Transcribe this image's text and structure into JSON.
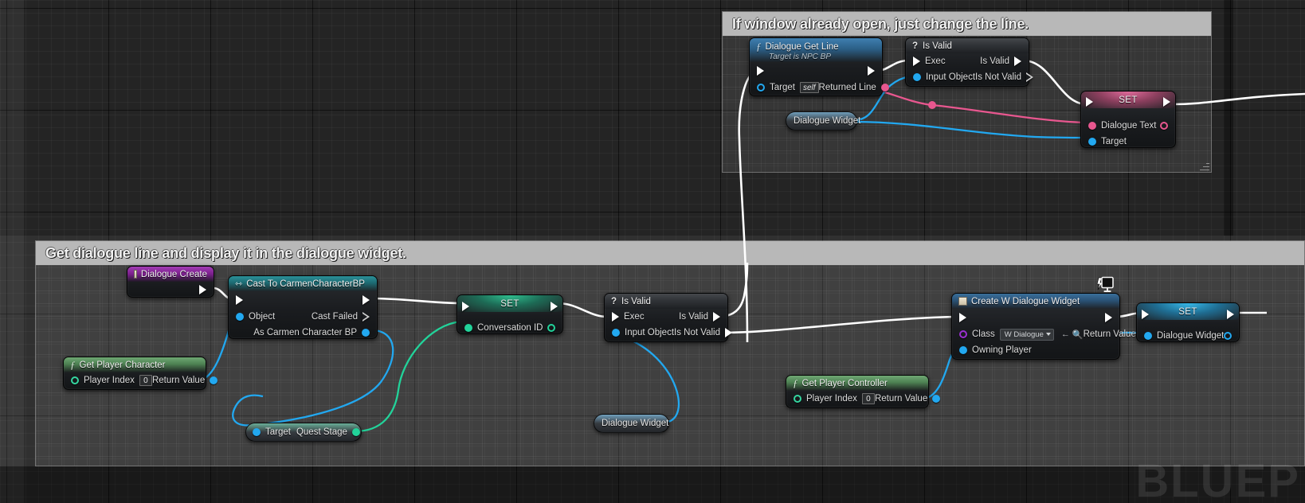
{
  "app": {
    "editor": "Unreal Engine Blueprint Graph",
    "watermark": "BLUEP"
  },
  "comments": [
    {
      "id": "comment-top",
      "title": "If window already open, just change the line."
    },
    {
      "id": "comment-bottom",
      "title": "Get dialogue line and display it in the dialogue widget."
    }
  ],
  "nodes": {
    "dialogue_get_line": {
      "title": "Dialogue Get Line",
      "subtitle": "Target is NPC BP",
      "icon": "function-icon",
      "pins": {
        "exec_in": "",
        "exec_out": "",
        "target_label": "Target",
        "target_value": "self",
        "returned_line": "Returned Line"
      }
    },
    "is_valid_top": {
      "title": "Is Valid",
      "icon": "question-icon",
      "pins": {
        "exec": "Exec",
        "input_object": "Input Object",
        "is_valid": "Is Valid",
        "is_not_valid": "Is Not Valid"
      }
    },
    "dialogue_widget_getter_top": {
      "label": "Dialogue Widget"
    },
    "set_dialogue_text": {
      "title": "SET",
      "pins": {
        "dialogue_text": "Dialogue Text",
        "target": "Target"
      }
    },
    "dialogue_create": {
      "title": "Dialogue Create",
      "icon": "event-icon"
    },
    "cast_to_carmen": {
      "title": "Cast To CarmenCharacterBP",
      "icon": "cast-icon",
      "pins": {
        "object": "Object",
        "cast_failed": "Cast Failed",
        "as_carmen": "As Carmen Character BP"
      }
    },
    "get_player_character": {
      "title": "Get Player Character",
      "icon": "function-icon",
      "pins": {
        "player_index": "Player Index",
        "player_index_value": "0",
        "return_value": "Return Value"
      }
    },
    "set_conversation_id": {
      "title": "SET",
      "pins": {
        "conversation_id": "Conversation ID"
      }
    },
    "is_valid_bottom": {
      "title": "Is Valid",
      "icon": "question-icon",
      "pins": {
        "exec": "Exec",
        "input_object": "Input Object",
        "is_valid": "Is Valid",
        "is_not_valid": "Is Not Valid"
      }
    },
    "dialogue_widget_getter_bottom": {
      "label": "Dialogue Widget"
    },
    "target_quest_stage": {
      "target": "Target",
      "quest_stage": "Quest Stage"
    },
    "get_player_controller": {
      "title": "Get Player Controller",
      "icon": "function-icon",
      "pins": {
        "player_index": "Player Index",
        "player_index_value": "0",
        "return_value": "Return Value"
      }
    },
    "create_w_dialogue_widget": {
      "title": "Create W Dialogue Widget",
      "icon": "widget-icon",
      "badge": "monitor-icon",
      "pins": {
        "class_label": "Class",
        "class_value": "W Dialogue",
        "owning_player": "Owning Player",
        "return_value": "Return Value"
      }
    },
    "set_dialogue_widget": {
      "title": "SET",
      "pins": {
        "dialogue_widget": "Dialogue Widget"
      }
    }
  },
  "colors": {
    "exec_white": "#ffffff",
    "object_blue": "#22a8f0",
    "text_pink": "#e8578f",
    "struct_green": "#22d39a",
    "class_purple": "#9b30d0",
    "int_green": "#35d6a0",
    "comment_bar": "#b8b8b8"
  }
}
